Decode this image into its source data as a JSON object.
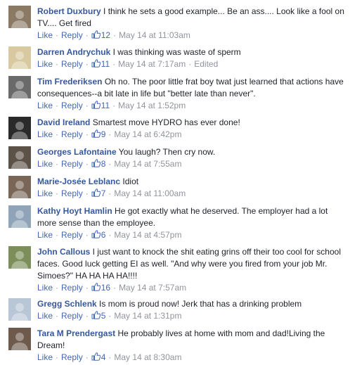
{
  "action_labels": {
    "like": "Like",
    "reply": "Reply",
    "dot": "·",
    "edited": "Edited"
  },
  "comments": [
    {
      "name": "Robert Duxbury",
      "text": " I think he sets a good example... Be an ass.... Look like a fool on TV.... Get fired",
      "likes": "12",
      "time": "May 14 at 11:03am",
      "avatar_color": "#8a7a64"
    },
    {
      "name": "Darren Andrychuk",
      "text": " I was thinking was waste of sperm",
      "likes": "11",
      "time": "May 14 at 7:17am",
      "edited": true,
      "avatar_color": "#d8c9a0"
    },
    {
      "name": "Tim Frederiksen",
      "text": " Oh no. The poor little frat boy twat just learned that actions have consequences--a bit late in life but \"better late than never\".",
      "likes": "11",
      "time": "May 14 at 1:52pm",
      "avatar_color": "#6a6a6a"
    },
    {
      "name": "David Ireland",
      "text": " Smartest move HYDRO has ever done!",
      "likes": "9",
      "time": "May 14 at 6:42pm",
      "avatar_color": "#2a2a2a"
    },
    {
      "name": "Georges Lafontaine",
      "text": " You laugh? Then cry now.",
      "likes": "8",
      "time": "May 14 at 7:55am",
      "avatar_color": "#5c5247"
    },
    {
      "name": "Marie-Josée Leblanc",
      "text": " Idiot",
      "likes": "7",
      "time": "May 14 at 11:00am",
      "avatar_color": "#7a6656"
    },
    {
      "name": "Kathy Hoyt Hamlin",
      "text": " He got exactly what he deserved. The employer had a lot more sense than the employee.",
      "likes": "6",
      "time": "May 14 at 4:57pm",
      "avatar_color": "#8fa4b8"
    },
    {
      "name": "John Callous",
      "text": " I just want to knock the shit eating grins off their too cool for school faces. Good luck getting EI as well. \"And why were you fired from your job Mr. Simoes?\" HA HA HA HA!!!!",
      "likes": "16",
      "time": "May 14 at 7:57am",
      "avatar_color": "#7c8f5a"
    },
    {
      "name": "Gregg Schlenk",
      "text": " Is mom is proud now! Jerk that has a drinking problem",
      "likes": "5",
      "time": "May 14 at 1:31pm",
      "avatar_color": "#b9c6d6"
    },
    {
      "name": "Tara M Prendergast",
      "text": " He probably lives at home with mom and dad!Living the Dream!",
      "likes": "4",
      "time": "May 14 at 8:30am",
      "avatar_color": "#6e5a4c"
    }
  ]
}
